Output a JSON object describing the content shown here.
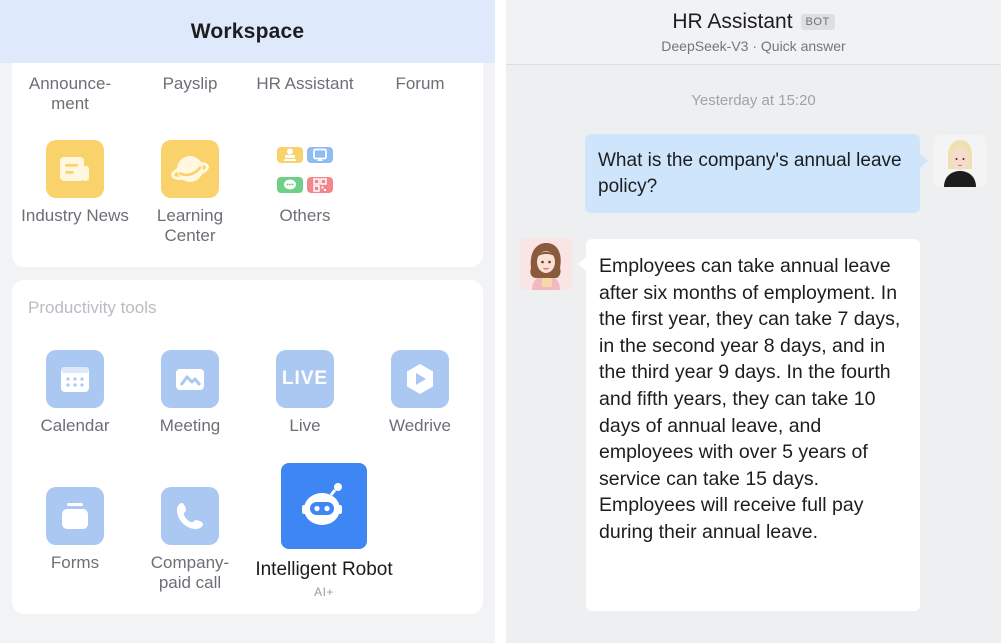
{
  "left": {
    "header_title": "Workspace",
    "top_row": [
      "Announce-\nment",
      "Payslip",
      "HR Assistant",
      "Forum"
    ],
    "apps1": [
      {
        "label": "Industry News",
        "icon": "news-icon"
      },
      {
        "label": "Learning\nCenter",
        "icon": "learning-icon"
      },
      {
        "label": "Others",
        "icon": "others-grid-icon"
      }
    ],
    "productivity": {
      "title": "Productivity tools",
      "apps": [
        {
          "label": "Calendar",
          "icon": "calendar-icon"
        },
        {
          "label": "Meeting",
          "icon": "meeting-icon"
        },
        {
          "label": "Live",
          "icon": "live-icon",
          "icon_text": "LIVE"
        },
        {
          "label": "Wedrive",
          "icon": "wedrive-icon"
        },
        {
          "label": "Forms",
          "icon": "forms-icon"
        },
        {
          "label": "Company-\npaid call",
          "icon": "phone-icon"
        }
      ],
      "robot": {
        "label": "Intelligent Robot",
        "sub": "AI+",
        "icon": "robot-icon"
      }
    }
  },
  "chat": {
    "title": "HR Assistant",
    "badge": "BOT",
    "subtitle": "DeepSeek-V3 · Quick answer",
    "timestamp": "Yesterday at 15:20",
    "user_message": "What is the company's annual leave policy?",
    "bot_message": "Employees can take annual leave after six months of employment. In the first year, they can take 7 days, in the second year 8 days, and in the third year 9 days. In the fourth and fifth years, they can take 10 days of annual leave, and employees with over 5 years of service can take 15 days. Employees will receive full pay during their annual leave."
  },
  "colors": {
    "header_bg": "#dee9fb",
    "user_bubble": "#cfe5fb",
    "robot_blue": "#3e86f3",
    "app_yellow": "#f9d26b",
    "app_blue": "#aac8f2"
  }
}
